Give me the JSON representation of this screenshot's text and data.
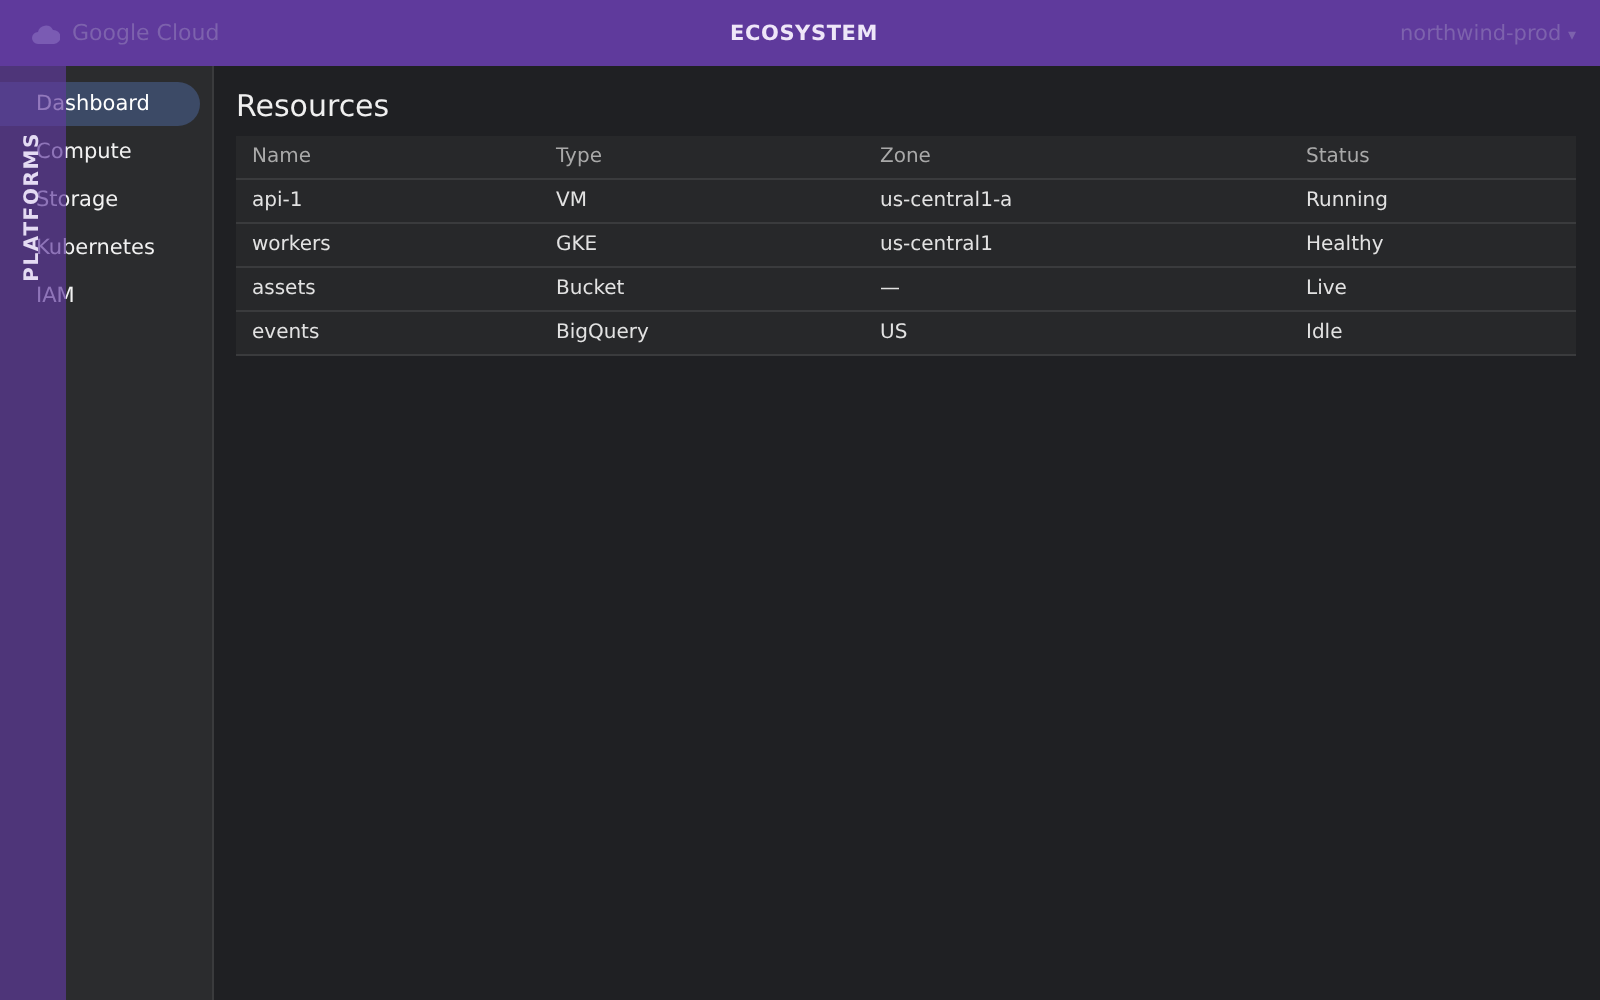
{
  "header": {
    "brand": "Google Cloud",
    "project": "northwind-prod",
    "project_caret": "▾"
  },
  "overlay_top": {
    "title": "ECOSYSTEM"
  },
  "overlay_side": {
    "title": "PLATFORMS"
  },
  "sidebar": {
    "items": [
      {
        "label": "Dashboard",
        "selected": true
      },
      {
        "label": "Compute",
        "selected": false
      },
      {
        "label": "Storage",
        "selected": false
      },
      {
        "label": "Kubernetes",
        "selected": false
      },
      {
        "label": "IAM",
        "selected": false
      }
    ]
  },
  "main": {
    "title": "Resources",
    "table": {
      "columns": [
        "Name",
        "Type",
        "Zone",
        "Status"
      ],
      "rows": [
        [
          "api-1",
          "VM",
          "us-central1-a",
          "Running"
        ],
        [
          "workers",
          "GKE",
          "us-central1",
          "Healthy"
        ],
        [
          "assets",
          "Bucket",
          "—",
          "Live"
        ],
        [
          "events",
          "BigQuery",
          "US",
          "Idle"
        ]
      ]
    }
  }
}
